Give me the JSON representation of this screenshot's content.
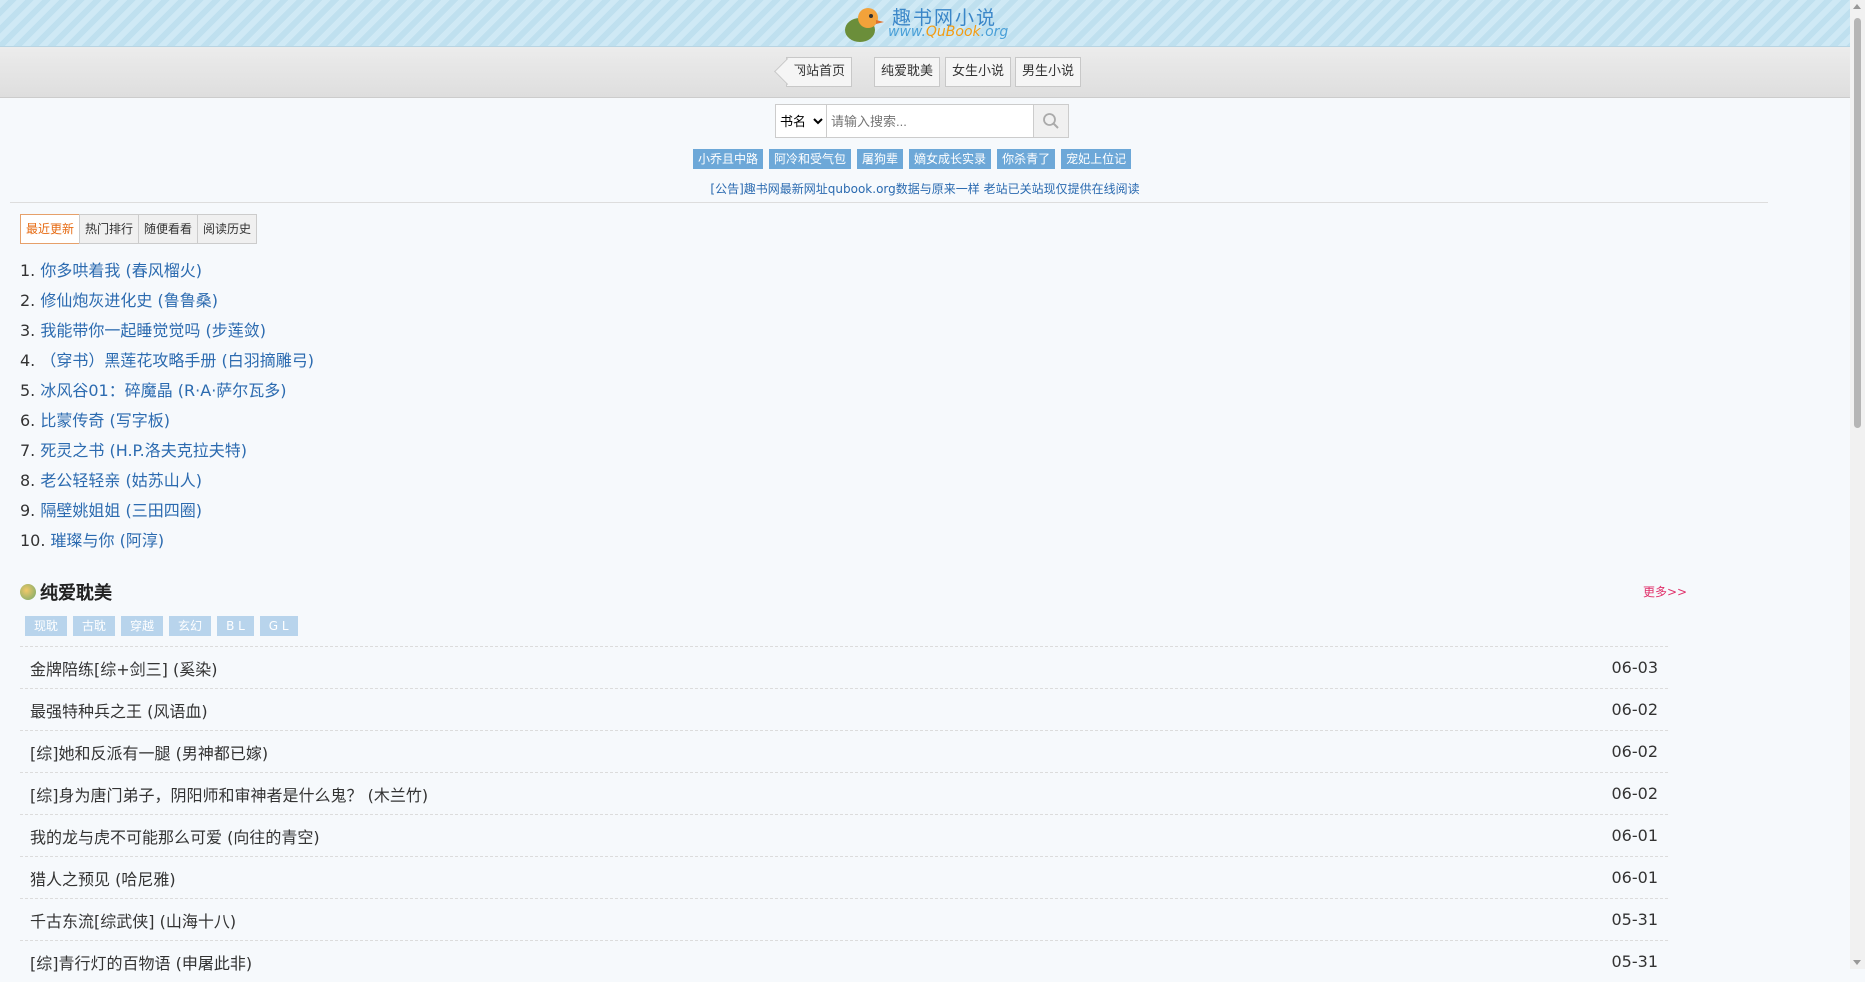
{
  "logo": {
    "text": "趣书网小说",
    "url_prefix": "www.",
    "url_mid": "QuBook",
    "url_suffix": ".org"
  },
  "nav": [
    "网站首页",
    "纯爱耽美",
    "女生小说",
    "男生小说"
  ],
  "search": {
    "select": "书名",
    "placeholder": "请输入搜索..."
  },
  "hot_tags": [
    "小乔且中路",
    "阿冷和受气包",
    "屠狗辈",
    "嫡女成长实录",
    "你杀青了",
    "宠妃上位记"
  ],
  "notice": "[公告]趣书网最新网址qubook.org数据与原来一样 老站已关站现仅提供在线阅读",
  "tabs": [
    "最近更新",
    "热门排行",
    "随便看看",
    "阅读历史"
  ],
  "recent": [
    {
      "num": "1.",
      "title": "你多哄着我 (春风榴火)"
    },
    {
      "num": "2.",
      "title": "修仙炮灰进化史 (鲁鲁桑)"
    },
    {
      "num": "3.",
      "title": "我能带你一起睡觉觉吗 (步莲敛)"
    },
    {
      "num": "4.",
      "title": "（穿书）黑莲花攻略手册 (白羽摘雕弓)"
    },
    {
      "num": "5.",
      "title": "冰风谷01：碎魔晶 (R·A·萨尔瓦多)"
    },
    {
      "num": "6.",
      "title": "比蒙传奇 (写字板)"
    },
    {
      "num": "7.",
      "title": "死灵之书 (H.P.洛夫克拉夫特)"
    },
    {
      "num": "8.",
      "title": "老公轻轻亲 (姑苏山人)"
    },
    {
      "num": "9.",
      "title": "隔壁姚姐姐 (三田四圈)"
    },
    {
      "num": "10.",
      "title": "璀璨与你 (阿淳)"
    }
  ],
  "section": {
    "title": "纯爱耽美",
    "more": "更多>>",
    "cats": [
      "现耽",
      "古耽",
      "穿越",
      "玄幻",
      "B L",
      "G L"
    ],
    "books": [
      {
        "title": "金牌陪练[综+剑三] (奚染)",
        "date": "06-03"
      },
      {
        "title": "最强特种兵之王 (风语血)",
        "date": "06-02"
      },
      {
        "title": "[综]她和反派有一腿 (男神都已嫁)",
        "date": "06-02"
      },
      {
        "title": "[综]身为唐门弟子，阴阳师和审神者是什么鬼？ (木兰竹)",
        "date": "06-02"
      },
      {
        "title": "我的龙与虎不可能那么可爱 (向往的青空)",
        "date": "06-01"
      },
      {
        "title": "猎人之预见 (哈尼雅)",
        "date": "06-01"
      },
      {
        "title": "千古东流[综武侠] (山海十八)",
        "date": "05-31"
      },
      {
        "title": "[综]青行灯的百物语 (申屠此非)",
        "date": "05-31"
      }
    ]
  }
}
